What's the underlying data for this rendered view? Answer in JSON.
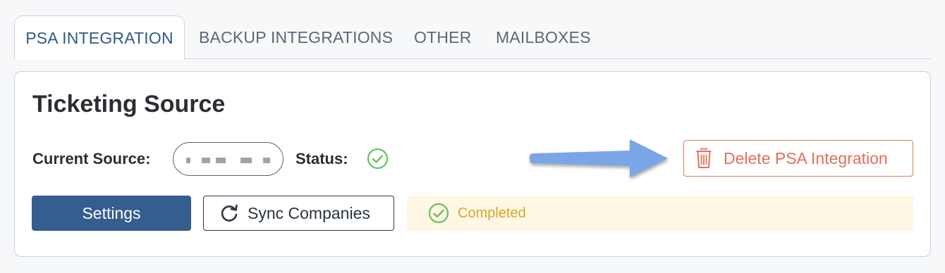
{
  "tabs": [
    {
      "label": "PSA INTEGRATION",
      "active": true
    },
    {
      "label": "BACKUP INTEGRATIONS",
      "active": false
    },
    {
      "label": "OTHER",
      "active": false
    },
    {
      "label": "MAILBOXES",
      "active": false
    }
  ],
  "card": {
    "title": "Ticketing Source",
    "current_source_label": "Current Source:",
    "status_label": "Status:",
    "status_icon": "check-circle-icon",
    "delete_button_label": "Delete PSA Integration",
    "settings_button_label": "Settings",
    "sync_button_label": "Sync Companies",
    "sync_status_text": "Completed"
  },
  "colors": {
    "accent": "#355d8d",
    "danger": "#e0715c",
    "success": "#6cbf62",
    "warning_text": "#d2a82a",
    "annotation_arrow": "#7aa6e8"
  }
}
